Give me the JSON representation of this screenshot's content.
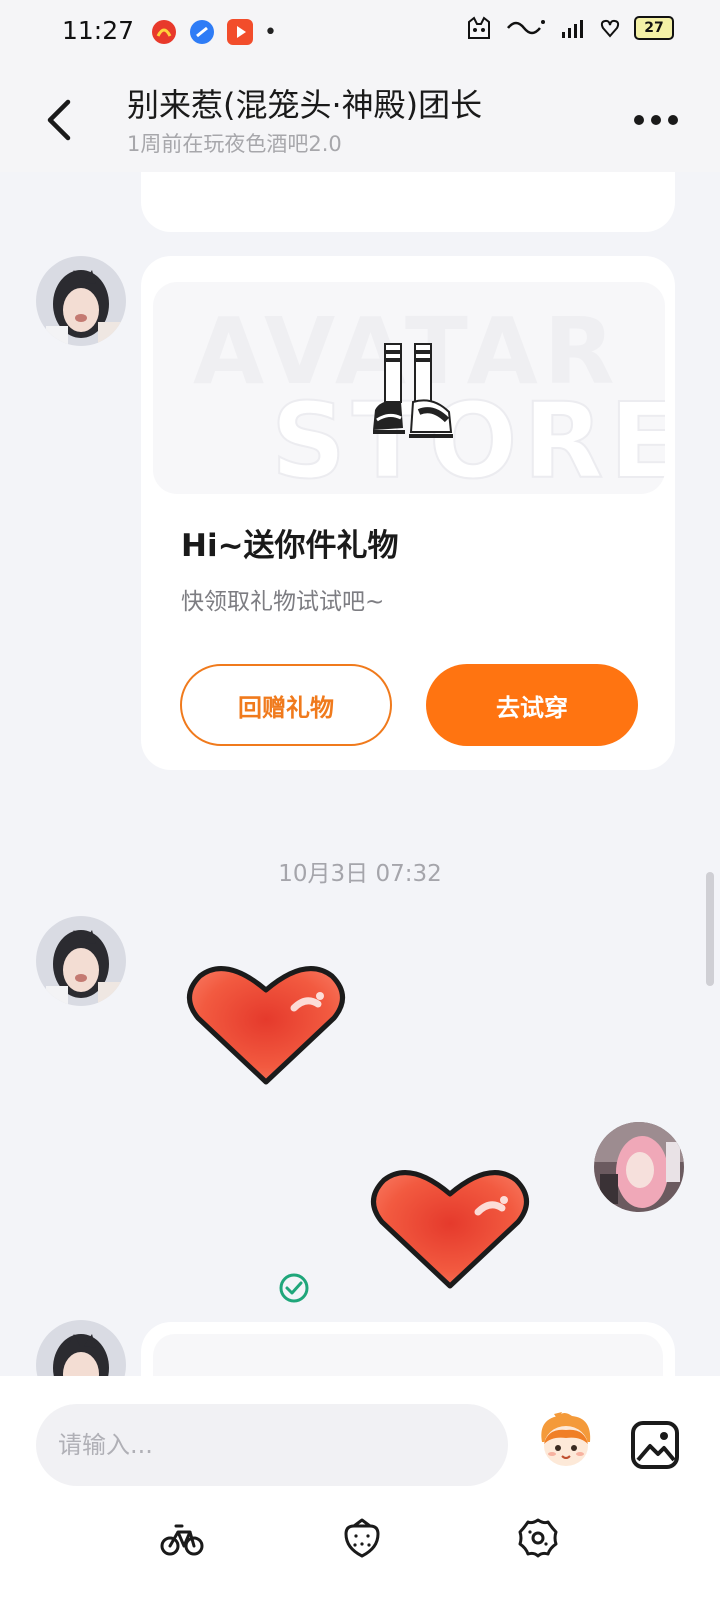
{
  "status_bar": {
    "time": "11:27",
    "battery": "27",
    "dot": "•"
  },
  "header": {
    "title": "别来惹(混笼头·神殿)团长",
    "subtitle": "1周前在玩夜色酒吧2.0"
  },
  "messages": {
    "gift_card": {
      "banner_watermark_top": "AVATAR",
      "banner_watermark_bottom": "STORE",
      "title": "Hi~送你件礼物",
      "description": "快领取礼物试试吧~",
      "return_gift_label": "回赠礼物",
      "try_on_label": "去试穿"
    },
    "timestamp": "10月3日 07:32"
  },
  "input": {
    "placeholder": "请输入..."
  },
  "colors": {
    "accent": "#ff7411",
    "outline": "#f07a1c",
    "background": "#f3f4f8",
    "read_check": "#1fa67a"
  }
}
